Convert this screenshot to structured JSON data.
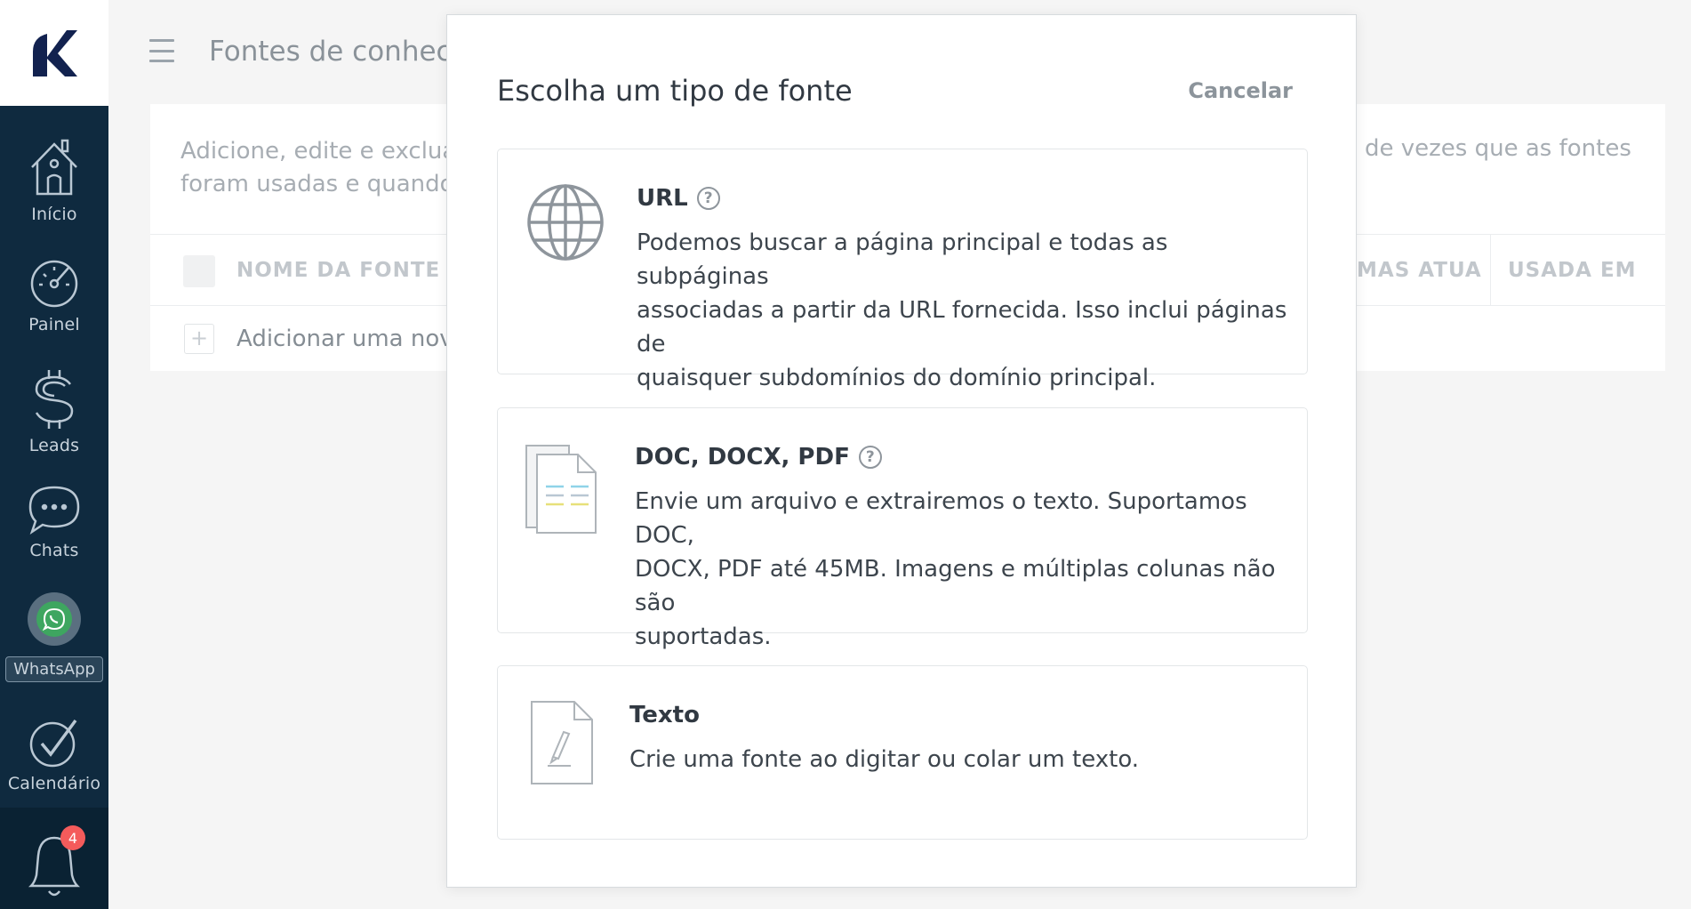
{
  "sidebar": {
    "items": [
      {
        "label": "Início",
        "icon": "home-icon"
      },
      {
        "label": "Painel",
        "icon": "dashboard-gauge-icon"
      },
      {
        "label": "Leads",
        "icon": "dollar-icon"
      },
      {
        "label": "Chats",
        "icon": "chat-bubble-icon"
      },
      {
        "label": "WhatsApp",
        "icon": "whatsapp-icon"
      },
      {
        "label": "Calendário",
        "icon": "checkmark-icon"
      }
    ],
    "notification_count": "4"
  },
  "header": {
    "title": "Fontes de conhecir"
  },
  "background": {
    "description_left_line1": "Adicione, edite e exclua s",
    "description_left_line2": "foram usadas e quando fo",
    "description_right": "de vezes que as fontes",
    "columns": [
      "NOME DA FONTE",
      "MAS ATUALI",
      "USADA EM"
    ],
    "add_row_label": "Adicionar uma nova"
  },
  "modal": {
    "title": "Escolha um tipo de fonte",
    "cancel_label": "Cancelar",
    "options": [
      {
        "title": "URL",
        "icon": "globe-icon",
        "help": "?",
        "description_lines": [
          "Podemos buscar a página principal e todas as subpáginas",
          "associadas a partir da URL fornecida. Isso inclui páginas de",
          "quaisquer subdomínios do domínio principal."
        ]
      },
      {
        "title": "DOC, DOCX, PDF",
        "icon": "documents-icon",
        "help": "?",
        "description_lines": [
          "Envie um arquivo e extrairemos o texto. Suportamos DOC,",
          "DOCX, PDF até 45MB. Imagens e múltiplas colunas não são",
          "suportadas."
        ]
      },
      {
        "title": "Texto",
        "icon": "text-file-pen-icon",
        "description_lines": [
          "Crie uma fonte ao digitar ou colar um texto."
        ]
      }
    ]
  },
  "colors": {
    "sidebar_bg": "#0f2a3f",
    "logo": "#12224f",
    "whatsapp_green": "#3ea660",
    "badge_red": "#f45b5b"
  }
}
